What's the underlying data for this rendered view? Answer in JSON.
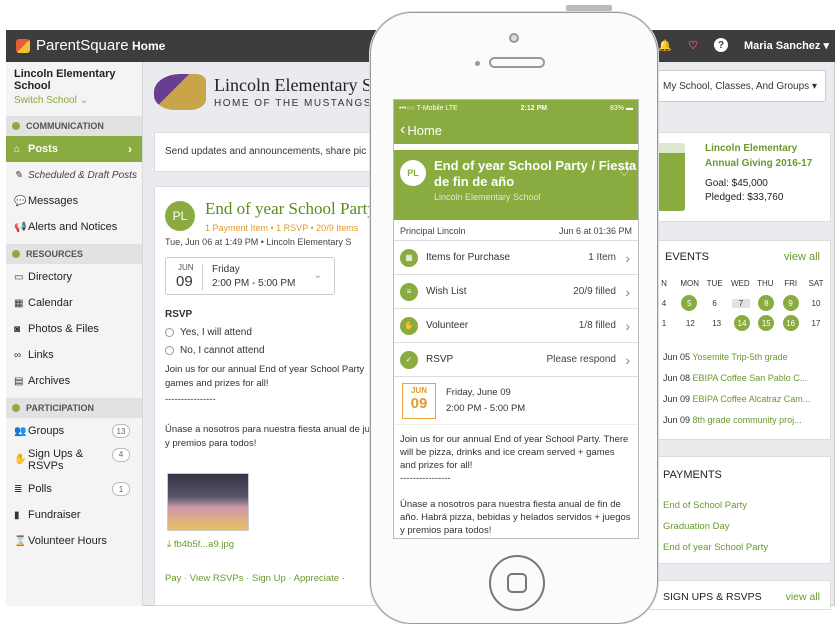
{
  "app": {
    "name": "ParentSquare",
    "home": "Home",
    "user": "Maria Sanchez"
  },
  "sidebar": {
    "school": "Lincoln Elementary School",
    "switch": "Switch School",
    "sections": {
      "communication": "COMMUNICATION",
      "resources": "RESOURCES",
      "participation": "PARTICIPATION"
    },
    "comm_items": [
      {
        "label": "Posts"
      },
      {
        "label": "Scheduled & Draft Posts"
      },
      {
        "label": "Messages"
      },
      {
        "label": "Alerts and Notices"
      }
    ],
    "res_items": [
      {
        "label": "Directory"
      },
      {
        "label": "Calendar"
      },
      {
        "label": "Photos & Files"
      },
      {
        "label": "Links"
      },
      {
        "label": "Archives"
      }
    ],
    "part_items": [
      {
        "label": "Groups",
        "count": "13"
      },
      {
        "label": "Sign Ups & RSVPs",
        "count": "4"
      },
      {
        "label": "Polls",
        "count": "1"
      },
      {
        "label": "Fundraiser"
      },
      {
        "label": "Volunteer Hours"
      }
    ]
  },
  "banner": {
    "title": "Lincoln Elementary S",
    "subtitle": "HOME OF THE MUSTANGS"
  },
  "compose": {
    "placeholder": "Send updates and announcements, share pic"
  },
  "post": {
    "initials": "PL",
    "title": "End of year School Party",
    "meta": "1 Payment Item • 1 RSVP • 20/9 Items",
    "date": "Tue, Jun 06 at 1:49 PM • Lincoln Elementary S",
    "event": {
      "month": "JUN",
      "day": "09",
      "weekday": "Friday",
      "time": "2:00 PM - 5:00 PM"
    },
    "rsvp_label": "RSVP",
    "rsvp_yes": "Yes, I will attend",
    "rsvp_no": "No, I cannot attend",
    "text1": "Join us for our annual End of year School Party games and prizes for all!",
    "divider": "----------------",
    "text2": "Únase a nosotros para nuestra fiesta anual de juegos y premios para todos!",
    "file": "fb4b5f...a9.jpg",
    "actions": "Pay · View RSVPs · Sign Up · Appreciate · "
  },
  "right": {
    "select": "My School, Classes, And Groups",
    "giving": {
      "title1": "Lincoln Elementary",
      "title2": "Annual Giving 2016-17",
      "goal": "Goal: $45,000",
      "pledged": "Pledged: $33,760"
    },
    "events": {
      "heading": "EVENTS",
      "view_all": "view all",
      "days": [
        "N",
        "MON",
        "TUE",
        "WED",
        "THU",
        "FRI",
        "SAT"
      ],
      "week1": [
        "4",
        "5",
        "6",
        "7",
        "8",
        "9",
        "10"
      ],
      "week2": [
        "1",
        "12",
        "13",
        "14",
        "15",
        "16",
        "17"
      ],
      "list": [
        {
          "date": "Jun 05",
          "title": "Yosemite Trip-5th grade"
        },
        {
          "date": "Jun 08",
          "title": "EBIPA Coffee San Pablo C..."
        },
        {
          "date": "Jun 09",
          "title": "EBIPA Coffee Alcatraz Cam..."
        },
        {
          "date": "Jun 09",
          "title": "8th grade community proj..."
        }
      ]
    },
    "payments": {
      "heading": "PAYMENTS",
      "items": [
        "End of School Party",
        "Graduation Day",
        "End of year School Party"
      ]
    },
    "signups": {
      "heading": "SIGN UPS & RSVPS",
      "view_all": "view all"
    }
  },
  "phone": {
    "carrier": "•••○○ T-Mobile  LTE",
    "clock": "2:12 PM",
    "battery": "83%",
    "back": "Home",
    "title": "End of year School Party / Fiesta de fin de año",
    "school": "Lincoln Elementary School",
    "author": "Principal Lincoln",
    "posted": "Jun 6 at 01:36 PM",
    "rows": [
      {
        "label": "Items for Purchase",
        "value": "1 Item"
      },
      {
        "label": "Wish List",
        "value": "20/9 filled"
      },
      {
        "label": "Volunteer",
        "value": "1/8 filled"
      },
      {
        "label": "RSVP",
        "value": "Please respond"
      }
    ],
    "event": {
      "month": "JUN",
      "day": "09",
      "date": "Friday, June 09",
      "time": "2:00 PM - 5:00 PM"
    },
    "body1": "Join us for our annual End of year School Party. There will be pizza, drinks and ice cream served + games and prizes for all!",
    "divider": "----------------",
    "body2": "Únase a nosotros para nuestra fiesta anual de fin de año. Habrá pizza, bebidas y helados servidos + juegos y premios para todos!"
  }
}
